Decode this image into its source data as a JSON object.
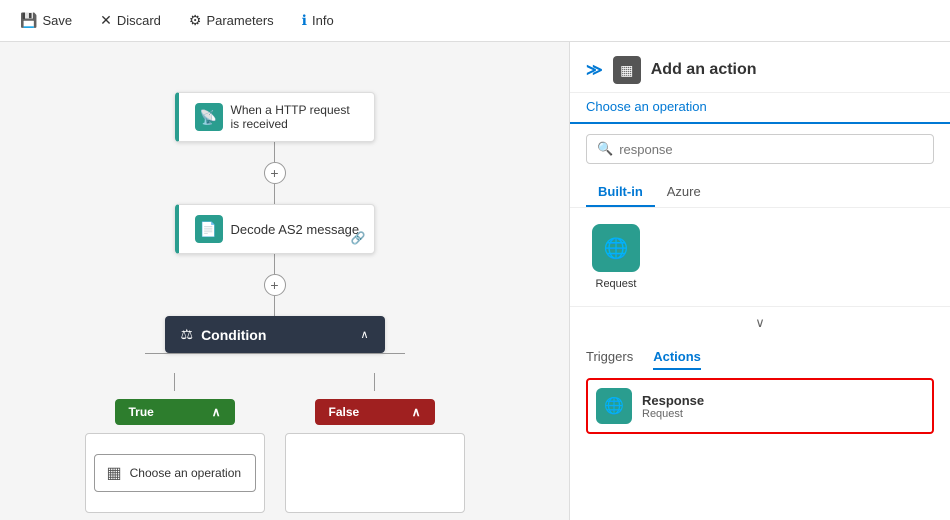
{
  "toolbar": {
    "save_label": "Save",
    "discard_label": "Discard",
    "parameters_label": "Parameters",
    "info_label": "Info"
  },
  "canvas": {
    "http_block_line1": "When a HTTP request",
    "http_block_line2": "is received",
    "decode_block_label": "Decode AS2 message",
    "condition_label": "Condition",
    "true_label": "True",
    "false_label": "False",
    "choose_operation_label": "Choose an operation"
  },
  "panel": {
    "title": "Add an action",
    "subtitle": "Choose an operation",
    "search_placeholder": "response",
    "tab_builtin": "Built-in",
    "tab_azure": "Azure",
    "tab_triggers": "Triggers",
    "tab_actions": "Actions",
    "icons": [
      {
        "label": "Request",
        "icon": "🌐"
      }
    ],
    "actions": [
      {
        "name": "Response",
        "sub": "Request",
        "selected": true,
        "icon": "🌐"
      }
    ]
  },
  "icons": {
    "save": "💾",
    "discard": "✕",
    "parameters": "⚙",
    "info": "ℹ",
    "search": "🔍",
    "plus": "+",
    "chevron_up": "∧",
    "chevron_down": "∨",
    "link": "🔗",
    "collapse": "≫",
    "http_icon": "📡",
    "decode_icon": "📄",
    "condition_icon": "⚖",
    "choose_icon": "▦"
  }
}
